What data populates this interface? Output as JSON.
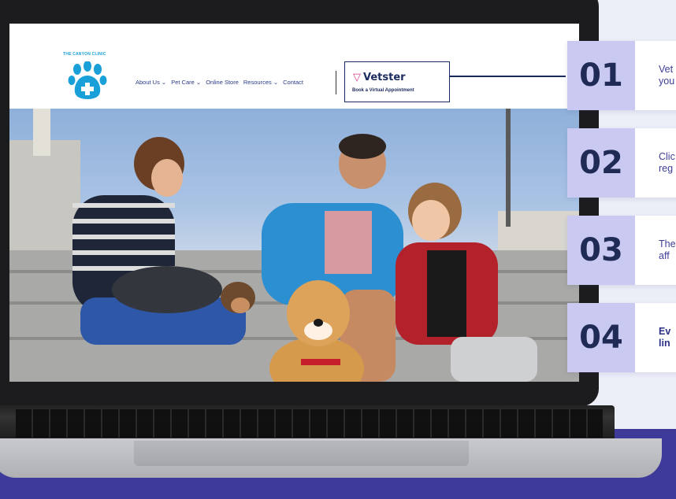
{
  "site": {
    "clinic_name": "THE CANYON CLINIC",
    "nav": [
      "About Us ⌄",
      "Pet Care ⌄",
      "Online Store",
      "Resources ⌄",
      "Contact"
    ],
    "vetster": {
      "logo_text": "Vetster",
      "subtitle": "Book a Virtual Appointment"
    }
  },
  "steps": [
    {
      "number": "01",
      "line1": "Vet",
      "line2": "you"
    },
    {
      "number": "02",
      "line1": "Clic",
      "line2": "reg"
    },
    {
      "number": "03",
      "line1": "The",
      "line2": "aff"
    },
    {
      "number": "04",
      "line1": "Ev",
      "line2": "lin"
    }
  ],
  "colors": {
    "accent_purple": "#c9c9f2",
    "navy": "#1b2a5e",
    "band": "#3e3a9a",
    "paw_blue": "#1aa0d8"
  }
}
